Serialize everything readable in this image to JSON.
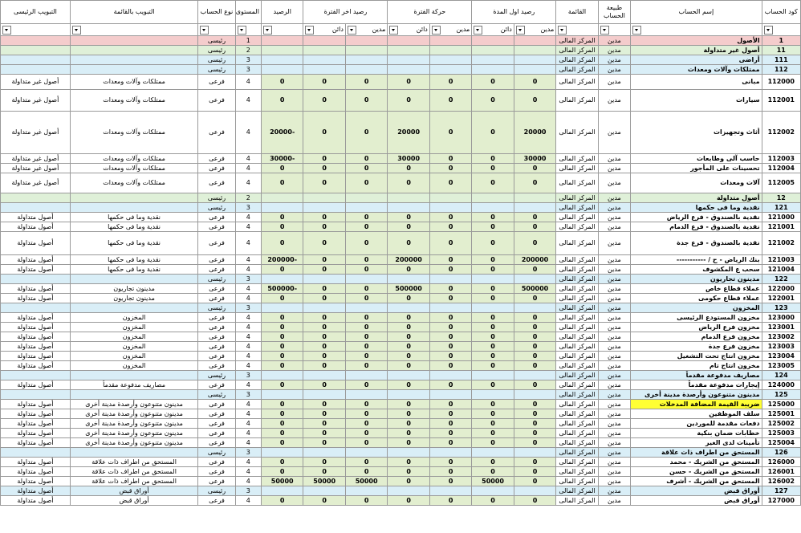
{
  "headers": {
    "code": "كود الحساب",
    "name": "إسم الحساب",
    "nature": "طبيعة الحساب",
    "statement": "القائمة",
    "opening": "رصيد اول المدة",
    "movement": "حركة الفترة",
    "closing": "رصيد اخر الفترة",
    "balance": "الرصيد",
    "level": "المستوى",
    "type": "نوع الحساب",
    "class_list": "التبويب بالقائمة",
    "class_main": "التبويب الرئيسى",
    "debit": "مدين",
    "credit": "دائن"
  },
  "rows": [
    {
      "style": "r-total",
      "code": "1",
      "name": "الأصول",
      "nature": "مدين",
      "stmt": "المركز المالى",
      "od": "",
      "oc": "",
      "md": "",
      "mc": "",
      "cd": "",
      "cc": "",
      "bal": "",
      "lvl": "1",
      "type": "رئيسى",
      "cls": "",
      "main": "",
      "h": 11
    },
    {
      "style": "r-main",
      "code": "11",
      "name": "أصول غير متداولة",
      "nature": "مدين",
      "stmt": "المركز المالى",
      "od": "",
      "oc": "",
      "md": "",
      "mc": "",
      "cd": "",
      "cc": "",
      "bal": "",
      "lvl": "2",
      "type": "رئيسى",
      "cls": "",
      "main": "",
      "h": 11
    },
    {
      "style": "r-sub",
      "code": "111",
      "name": "أراضى",
      "nature": "مدين",
      "stmt": "المركز المالى",
      "od": "",
      "oc": "",
      "md": "",
      "mc": "",
      "cd": "",
      "cc": "",
      "bal": "",
      "lvl": "3",
      "type": "رئيسى",
      "cls": "",
      "main": "",
      "h": 11
    },
    {
      "style": "r-sub",
      "code": "112",
      "name": "ممتلكات وآلات ومعدات",
      "nature": "مدين",
      "stmt": "المركز المالى",
      "od": "",
      "oc": "",
      "md": "",
      "mc": "",
      "cd": "",
      "cc": "",
      "bal": "",
      "lvl": "3",
      "type": "رئيسى",
      "cls": "",
      "main": "",
      "h": 11
    },
    {
      "style": "r-detail",
      "code": "112000",
      "name": "مبانى",
      "nature": "مدين",
      "stmt": "المركز المالى",
      "od": "0",
      "oc": "0",
      "md": "0",
      "mc": "0",
      "cd": "0",
      "cc": "0",
      "bal": "0",
      "lvl": "4",
      "type": "فرعى",
      "cls": "ممتلكات وآلات ومعدات",
      "main": "أصول غير متداولة",
      "h": 18
    },
    {
      "style": "r-detail",
      "code": "112001",
      "name": "سيارات",
      "nature": "مدين",
      "stmt": "المركز المالى",
      "od": "0",
      "oc": "0",
      "md": "0",
      "mc": "0",
      "cd": "0",
      "cc": "0",
      "bal": "0",
      "lvl": "4",
      "type": "فرعى",
      "cls": "ممتلكات وآلات ومعدات",
      "main": "أصول غير متداولة",
      "h": 26
    },
    {
      "style": "r-detail",
      "code": "112002",
      "name": "أثاث وتجهيزات",
      "nature": "مدين",
      "stmt": "المركز المالى",
      "od": "20000",
      "oc": "0",
      "md": "0",
      "mc": "20000",
      "cd": "0",
      "cc": "0",
      "bal": "-20000",
      "lvl": "4",
      "type": "فرعى",
      "cls": "ممتلكات وآلات ومعدات",
      "main": "أصول غير متداولة",
      "h": 52
    },
    {
      "style": "r-detail",
      "code": "112003",
      "name": "حاسب آلى وطابعات",
      "nature": "مدين",
      "stmt": "المركز المالى",
      "od": "30000",
      "oc": "0",
      "md": "0",
      "mc": "30000",
      "cd": "0",
      "cc": "0",
      "bal": "-30000",
      "lvl": "4",
      "type": "فرعى",
      "cls": "ممتلكات وآلات ومعدات",
      "main": "أصول غير متداولة",
      "h": 11
    },
    {
      "style": "r-detail",
      "code": "112004",
      "name": "تحسينات على المأجور",
      "nature": "مدين",
      "stmt": "المركز المالى",
      "od": "0",
      "oc": "0",
      "md": "0",
      "mc": "0",
      "cd": "0",
      "cc": "0",
      "bal": "0",
      "lvl": "4",
      "type": "فرعى",
      "cls": "ممتلكات وآلات ومعدات",
      "main": "أصول غير متداولة",
      "h": 11
    },
    {
      "style": "r-detail",
      "code": "112005",
      "name": "آلات ومعدات",
      "nature": "مدين",
      "stmt": "المركز المالى",
      "od": "0",
      "oc": "0",
      "md": "0",
      "mc": "0",
      "cd": "0",
      "cc": "0",
      "bal": "0",
      "lvl": "4",
      "type": "فرعى",
      "cls": "ممتلكات وآلات ومعدات",
      "main": "أصول غير متداولة",
      "h": 24
    },
    {
      "style": "r-main",
      "code": "12",
      "name": "أصول متداولة",
      "nature": "مدين",
      "stmt": "المركز المالى",
      "od": "",
      "oc": "",
      "md": "",
      "mc": "",
      "cd": "",
      "cc": "",
      "bal": "",
      "lvl": "2",
      "type": "رئيسى",
      "cls": "",
      "main": "",
      "h": 11
    },
    {
      "style": "r-sub",
      "code": "121",
      "name": "نقدية وما فى حكمها",
      "nature": "مدين",
      "stmt": "المركز المالى",
      "od": "",
      "oc": "",
      "md": "",
      "mc": "",
      "cd": "",
      "cc": "",
      "bal": "",
      "lvl": "3",
      "type": "رئيسى",
      "cls": "",
      "main": "",
      "h": 11
    },
    {
      "style": "r-detail",
      "code": "121000",
      "name": "نقدية بالصندوق - فرع الرياض",
      "nature": "مدين",
      "stmt": "المركز المالى",
      "od": "0",
      "oc": "0",
      "md": "0",
      "mc": "0",
      "cd": "0",
      "cc": "0",
      "bal": "0",
      "lvl": "4",
      "type": "فرعى",
      "cls": "نقدية وما فى حكمها",
      "main": "أصول متداولة",
      "h": 11
    },
    {
      "style": "r-detail",
      "code": "121001",
      "name": "نقدية بالصندوق - فرع الدمام",
      "nature": "مدين",
      "stmt": "المركز المالى",
      "od": "0",
      "oc": "0",
      "md": "0",
      "mc": "0",
      "cd": "0",
      "cc": "0",
      "bal": "0",
      "lvl": "4",
      "type": "فرعى",
      "cls": "نقدية وما فى حكمها",
      "main": "أصول متداولة",
      "h": 11
    },
    {
      "style": "r-detail",
      "code": "121002",
      "name": "نقدية بالصندوق - فرع جدة",
      "nature": "مدين",
      "stmt": "المركز المالى",
      "od": "0",
      "oc": "0",
      "md": "0",
      "mc": "0",
      "cd": "0",
      "cc": "0",
      "bal": "0",
      "lvl": "4",
      "type": "فرعى",
      "cls": "نقدية وما فى حكمها",
      "main": "أصول متداولة",
      "h": 28
    },
    {
      "style": "r-detail",
      "code": "121003",
      "name": "بنك الرياض - ح / -----------",
      "nature": "مدين",
      "stmt": "المركز المالى",
      "od": "200000",
      "oc": "0",
      "md": "0",
      "mc": "200000",
      "cd": "0",
      "cc": "0",
      "bal": "-200000",
      "lvl": "4",
      "type": "فرعى",
      "cls": "نقدية وما فى حكمها",
      "main": "أصول متداولة",
      "h": 11
    },
    {
      "style": "r-detail",
      "code": "121004",
      "name": "سحب ع المكشوف",
      "nature": "مدين",
      "stmt": "المركز المالى",
      "od": "0",
      "oc": "0",
      "md": "0",
      "mc": "0",
      "cd": "0",
      "cc": "0",
      "bal": "0",
      "lvl": "4",
      "type": "فرعى",
      "cls": "نقدية وما فى حكمها",
      "main": "أصول متداولة",
      "h": 11
    },
    {
      "style": "r-sub",
      "code": "122",
      "name": "مدينون تجاريون",
      "nature": "مدين",
      "stmt": "المركز المالى",
      "od": "",
      "oc": "",
      "md": "",
      "mc": "",
      "cd": "",
      "cc": "",
      "bal": "",
      "lvl": "3",
      "type": "رئيسى",
      "cls": "",
      "main": "",
      "h": 11
    },
    {
      "style": "r-detail",
      "code": "122000",
      "name": "عملاء قطاع خاص",
      "nature": "مدين",
      "stmt": "المركز المالى",
      "od": "500000",
      "oc": "0",
      "md": "0",
      "mc": "500000",
      "cd": "0",
      "cc": "0",
      "bal": "-500000",
      "lvl": "4",
      "type": "فرعى",
      "cls": "مدينون تجاريون",
      "main": "أصول متداولة",
      "h": 11
    },
    {
      "style": "r-detail",
      "code": "122001",
      "name": "عملاء قطاع حكومى",
      "nature": "مدين",
      "stmt": "المركز المالى",
      "od": "0",
      "oc": "0",
      "md": "0",
      "mc": "0",
      "cd": "0",
      "cc": "0",
      "bal": "0",
      "lvl": "4",
      "type": "فرعى",
      "cls": "مدينون تجاريون",
      "main": "أصول متداولة",
      "h": 11
    },
    {
      "style": "r-sub",
      "code": "123",
      "name": "المخزون",
      "nature": "مدين",
      "stmt": "المركز المالى",
      "od": "",
      "oc": "",
      "md": "",
      "mc": "",
      "cd": "",
      "cc": "",
      "bal": "",
      "lvl": "3",
      "type": "رئيسى",
      "cls": "",
      "main": "",
      "h": 11
    },
    {
      "style": "r-detail",
      "code": "123000",
      "name": "مخزون المستودع الرئيسى",
      "nature": "مدين",
      "stmt": "المركز المالى",
      "od": "0",
      "oc": "0",
      "md": "0",
      "mc": "0",
      "cd": "0",
      "cc": "0",
      "bal": "0",
      "lvl": "4",
      "type": "فرعى",
      "cls": "المخزون",
      "main": "أصول متداولة",
      "h": 11
    },
    {
      "style": "r-detail",
      "code": "123001",
      "name": "مخزون فرع الرياض",
      "nature": "مدين",
      "stmt": "المركز المالى",
      "od": "0",
      "oc": "0",
      "md": "0",
      "mc": "0",
      "cd": "0",
      "cc": "0",
      "bal": "0",
      "lvl": "4",
      "type": "فرعى",
      "cls": "المخزون",
      "main": "أصول متداولة",
      "h": 11
    },
    {
      "style": "r-detail",
      "code": "123002",
      "name": "مخزون فرع الدمام",
      "nature": "مدين",
      "stmt": "المركز المالى",
      "od": "0",
      "oc": "0",
      "md": "0",
      "mc": "0",
      "cd": "0",
      "cc": "0",
      "bal": "0",
      "lvl": "4",
      "type": "فرعى",
      "cls": "المخزون",
      "main": "أصول متداولة",
      "h": 11
    },
    {
      "style": "r-detail",
      "code": "123003",
      "name": "مخزون فرع جدة",
      "nature": "مدين",
      "stmt": "المركز المالى",
      "od": "0",
      "oc": "0",
      "md": "0",
      "mc": "0",
      "cd": "0",
      "cc": "0",
      "bal": "0",
      "lvl": "4",
      "type": "فرعى",
      "cls": "المخزون",
      "main": "أصول متداولة",
      "h": 11
    },
    {
      "style": "r-detail",
      "code": "123004",
      "name": "مخزون انتاج تحت التشغيل",
      "nature": "مدين",
      "stmt": "المركز المالى",
      "od": "0",
      "oc": "0",
      "md": "0",
      "mc": "0",
      "cd": "0",
      "cc": "0",
      "bal": "0",
      "lvl": "4",
      "type": "فرعى",
      "cls": "المخزون",
      "main": "أصول متداولة",
      "h": 11
    },
    {
      "style": "r-detail",
      "code": "123005",
      "name": "مخزون انتاج تام",
      "nature": "مدين",
      "stmt": "المركز المالى",
      "od": "0",
      "oc": "0",
      "md": "0",
      "mc": "0",
      "cd": "0",
      "cc": "0",
      "bal": "0",
      "lvl": "4",
      "type": "فرعى",
      "cls": "المخزون",
      "main": "أصول متداولة",
      "h": 11
    },
    {
      "style": "r-sub",
      "code": "124",
      "name": "مصاريف مدفوعة مقدماً",
      "nature": "مدين",
      "stmt": "المركز المالى",
      "od": "",
      "oc": "",
      "md": "",
      "mc": "",
      "cd": "",
      "cc": "",
      "bal": "",
      "lvl": "3",
      "type": "رئيسى",
      "cls": "",
      "main": "",
      "h": 11
    },
    {
      "style": "r-detail",
      "code": "124000",
      "name": "إيجارات مدفوعة مقدماً",
      "nature": "مدين",
      "stmt": "المركز المالى",
      "od": "0",
      "oc": "0",
      "md": "0",
      "mc": "0",
      "cd": "0",
      "cc": "0",
      "bal": "0",
      "lvl": "4",
      "type": "فرعى",
      "cls": "مصاريف مدفوعة مقدماً",
      "main": "أصول متداولة",
      "h": 11
    },
    {
      "style": "r-sub",
      "code": "125",
      "name": "مدينون متنوعون وأرصدة مدينة أخرى",
      "nature": "مدين",
      "stmt": "المركز المالى",
      "od": "",
      "oc": "",
      "md": "",
      "mc": "",
      "cd": "",
      "cc": "",
      "bal": "",
      "lvl": "3",
      "type": "رئيسى",
      "cls": "",
      "main": "",
      "h": 11
    },
    {
      "style": "r-detail",
      "code": "125000",
      "name": "ضريبة القيمة المضافة المدخلات",
      "nature": "مدين",
      "stmt": "المركز المالى",
      "od": "0",
      "oc": "0",
      "md": "0",
      "mc": "0",
      "cd": "0",
      "cc": "0",
      "bal": "0",
      "lvl": "4",
      "type": "فرعى",
      "cls": "مدينون متنوعون وأرصدة مدينة أخرى",
      "main": "أصول متداولة",
      "h": 11,
      "hl": true
    },
    {
      "style": "r-detail",
      "code": "125001",
      "name": "سلف الموظفين",
      "nature": "مدين",
      "stmt": "المركز المالى",
      "od": "0",
      "oc": "0",
      "md": "0",
      "mc": "0",
      "cd": "0",
      "cc": "0",
      "bal": "0",
      "lvl": "4",
      "type": "فرعى",
      "cls": "مدينون متنوعون وأرصدة مدينة أخرى",
      "main": "أصول متداولة",
      "h": 11
    },
    {
      "style": "r-detail",
      "code": "125002",
      "name": "دفعات مقدمة للموردين",
      "nature": "مدين",
      "stmt": "المركز المالى",
      "od": "0",
      "oc": "0",
      "md": "0",
      "mc": "0",
      "cd": "0",
      "cc": "0",
      "bal": "0",
      "lvl": "4",
      "type": "فرعى",
      "cls": "مدينون متنوعون وأرصدة مدينة أخرى",
      "main": "أصول متداولة",
      "h": 11
    },
    {
      "style": "r-detail",
      "code": "125003",
      "name": "خطابات ضمان بنكية",
      "nature": "مدين",
      "stmt": "المركز المالى",
      "od": "0",
      "oc": "0",
      "md": "0",
      "mc": "0",
      "cd": "0",
      "cc": "0",
      "bal": "0",
      "lvl": "4",
      "type": "فرعى",
      "cls": "مدينون متنوعون وأرصدة مدينة أخرى",
      "main": "أصول متداولة",
      "h": 11
    },
    {
      "style": "r-detail",
      "code": "125004",
      "name": "تأمينات لدى الغير",
      "nature": "مدين",
      "stmt": "المركز المالى",
      "od": "0",
      "oc": "0",
      "md": "0",
      "mc": "0",
      "cd": "0",
      "cc": "0",
      "bal": "0",
      "lvl": "4",
      "type": "فرعى",
      "cls": "مدينون متنوعون وأرصدة مدينة أخرى",
      "main": "أصول متداولة",
      "h": 11
    },
    {
      "style": "r-sub",
      "code": "126",
      "name": "المستحق من اطراف ذات علاقة",
      "nature": "مدين",
      "stmt": "المركز المالى",
      "od": "",
      "oc": "",
      "md": "",
      "mc": "",
      "cd": "",
      "cc": "",
      "bal": "",
      "lvl": "3",
      "type": "رئيسى",
      "cls": "",
      "main": "",
      "h": 11
    },
    {
      "style": "r-detail",
      "code": "126000",
      "name": "المستحق من الشريك - محمد",
      "nature": "مدين",
      "stmt": "المركز المالى",
      "od": "0",
      "oc": "0",
      "md": "0",
      "mc": "0",
      "cd": "0",
      "cc": "0",
      "bal": "0",
      "lvl": "4",
      "type": "فرعى",
      "cls": "المستحق من اطراف ذات علاقة",
      "main": "أصول متداولة",
      "h": 11
    },
    {
      "style": "r-detail",
      "code": "126001",
      "name": "المستحق من الشريك - حسن",
      "nature": "مدين",
      "stmt": "المركز المالى",
      "od": "0",
      "oc": "0",
      "md": "0",
      "mc": "0",
      "cd": "0",
      "cc": "0",
      "bal": "0",
      "lvl": "4",
      "type": "فرعى",
      "cls": "المستحق من اطراف ذات علاقة",
      "main": "أصول متداولة",
      "h": 11
    },
    {
      "style": "r-detail",
      "code": "126002",
      "name": "المستحق من الشريك - أشرف",
      "nature": "مدين",
      "stmt": "المركز المالى",
      "od": "0",
      "oc": "50000",
      "md": "0",
      "mc": "0",
      "cd": "50000",
      "cc": "50000",
      "bal": "50000",
      "lvl": "4",
      "type": "فرعى",
      "cls": "المستحق من اطراف ذات علاقة",
      "main": "أصول متداولة",
      "h": 11
    },
    {
      "style": "r-sub",
      "code": "127",
      "name": "أوراق قبض",
      "nature": "مدين",
      "stmt": "المركز المالى",
      "od": "",
      "oc": "",
      "md": "",
      "mc": "",
      "cd": "",
      "cc": "",
      "bal": "",
      "lvl": "3",
      "type": "رئيسى",
      "cls": "أوراق قبض",
      "main": "أصول متداولة",
      "h": 11
    },
    {
      "style": "r-detail",
      "code": "127000",
      "name": "أوراق قبض",
      "nature": "مدين",
      "stmt": "المركز المالى",
      "od": "0",
      "oc": "0",
      "md": "0",
      "mc": "0",
      "cd": "0",
      "cc": "0",
      "bal": "0",
      "lvl": "4",
      "type": "فرعى",
      "cls": "أوراق قبض",
      "main": "أصول متداولة",
      "h": 11
    }
  ]
}
